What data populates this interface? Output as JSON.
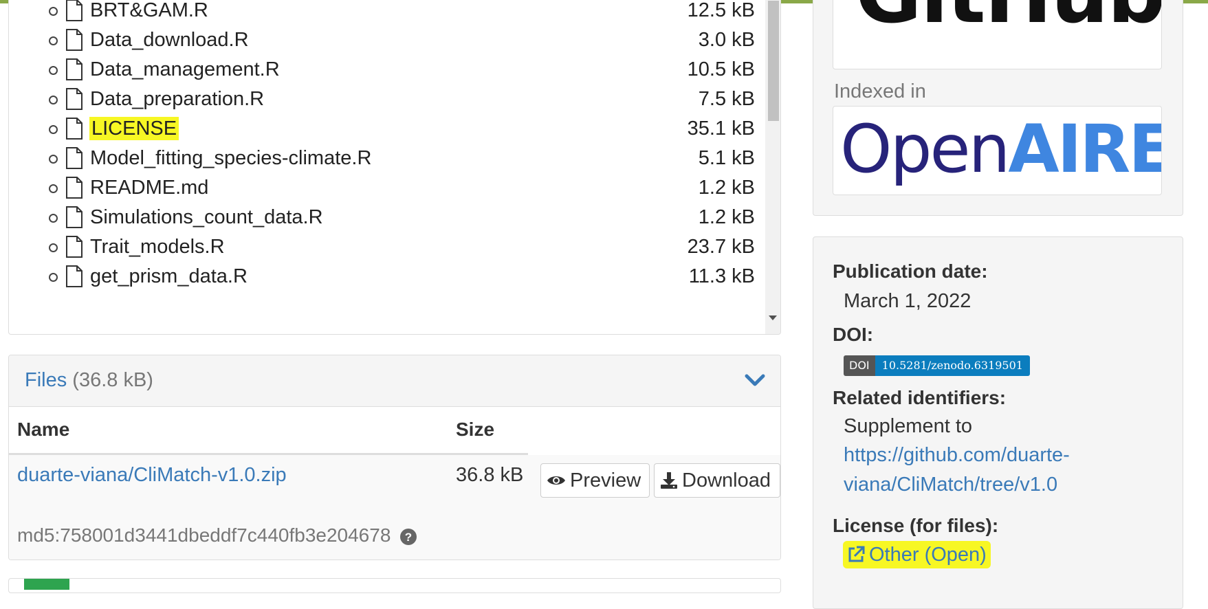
{
  "tree": {
    "files": [
      {
        "name": "BRT&GAM.R",
        "size": "12.5 kB",
        "highlighted": false
      },
      {
        "name": "Data_download.R",
        "size": "3.0 kB",
        "highlighted": false
      },
      {
        "name": "Data_management.R",
        "size": "10.5 kB",
        "highlighted": false
      },
      {
        "name": "Data_preparation.R",
        "size": "7.5 kB",
        "highlighted": false
      },
      {
        "name": "LICENSE",
        "size": "35.1 kB",
        "highlighted": true
      },
      {
        "name": "Model_fitting_species-climate.R",
        "size": "5.1 kB",
        "highlighted": false
      },
      {
        "name": "README.md",
        "size": "1.2 kB",
        "highlighted": false
      },
      {
        "name": "Simulations_count_data.R",
        "size": "1.2 kB",
        "highlighted": false
      },
      {
        "name": "Trait_models.R",
        "size": "23.7 kB",
        "highlighted": false
      },
      {
        "name": "get_prism_data.R",
        "size": "11.3 kB",
        "highlighted": false
      }
    ]
  },
  "files_box": {
    "title": "Files",
    "total_size": "(36.8 kB)",
    "col_name": "Name",
    "col_size": "Size",
    "file_name": "duarte-viana/CliMatch-v1.0.zip",
    "file_size": "36.8 kB",
    "preview_label": "Preview",
    "download_label": "Download",
    "md5": "md5:758001d3441dbeddf7c440fb3e204678"
  },
  "sidebar": {
    "logo_github": "GitHub",
    "indexed_label": "Indexed in",
    "logo_openaire_open": "Open",
    "logo_openaire_aire": "AIRE",
    "publication_date_label": "Publication date:",
    "publication_date": "March 1, 2022",
    "doi_label": "DOI:",
    "doi_badge_left": "DOI",
    "doi_value": "10.5281/zenodo.6319501",
    "related_label": "Related identifiers:",
    "related_text": "Supplement to",
    "related_link": "https://github.com/duarte-viana/CliMatch/tree/v1.0",
    "license_label": "License (for files):",
    "license_value": "Other (Open)"
  },
  "colors": {
    "link": "#3a7ab8",
    "highlight": "#f7f724",
    "doi_badge": "#0b7dbe",
    "top_bar": "#8aa848"
  }
}
